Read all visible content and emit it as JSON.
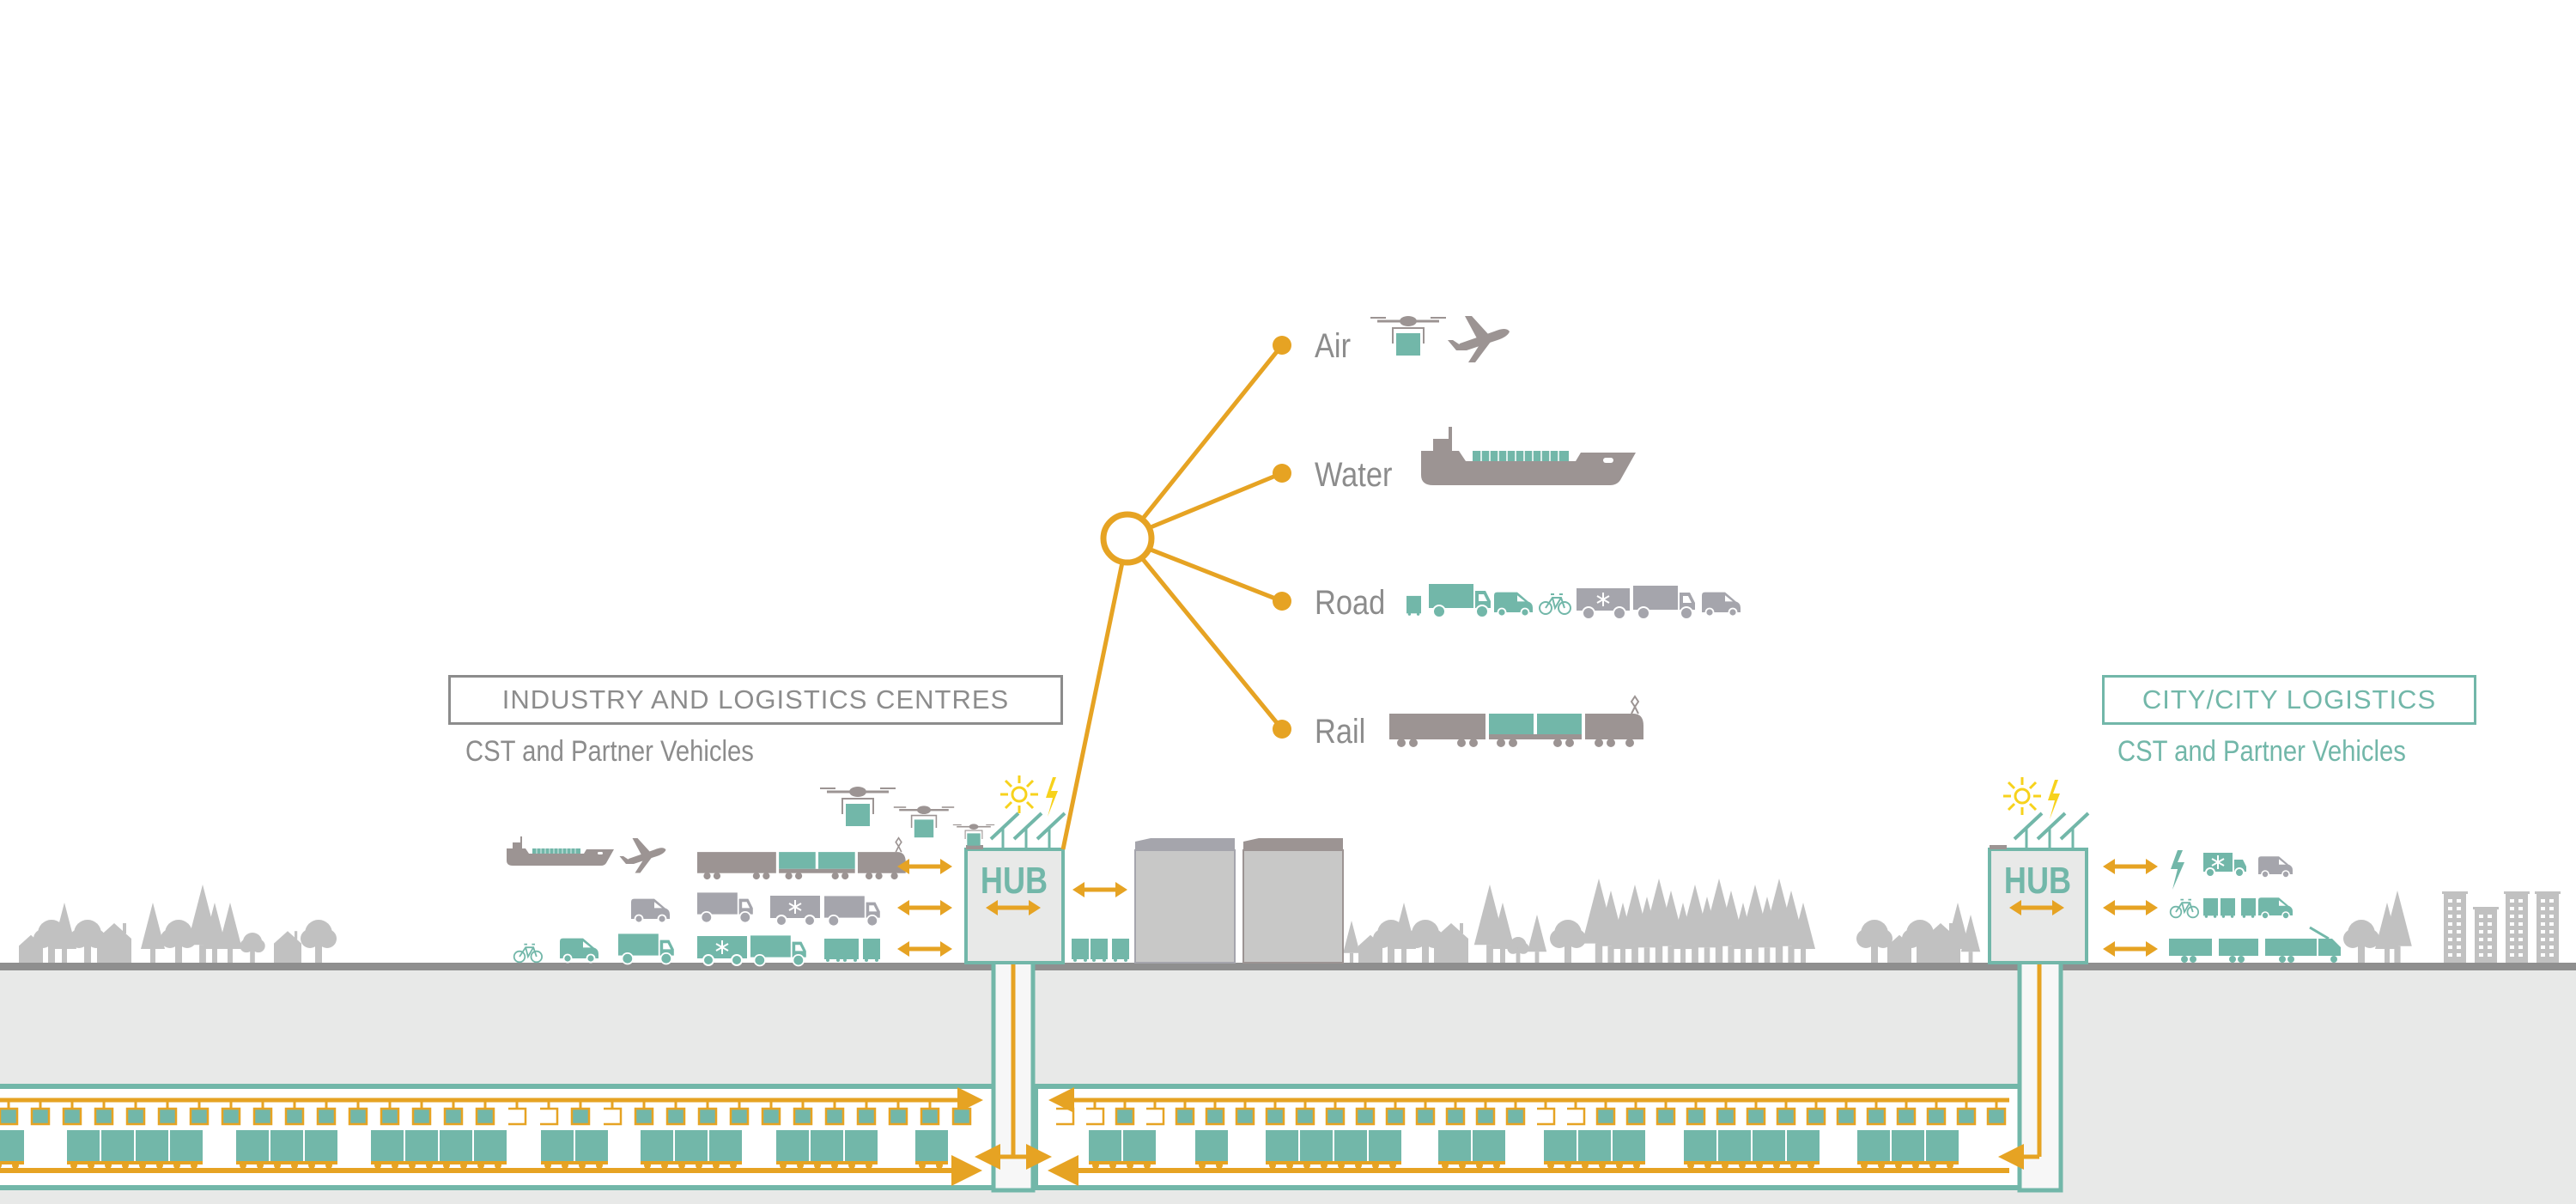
{
  "colors": {
    "orange": "#E6A323",
    "teal": "#72B7A9",
    "grey_vehicle": "#9C9493",
    "grey_truck": "#A5A5AC",
    "grey_skyline": "#C1C1C1",
    "ground_line": "#8F8F8F",
    "underground": "#E8E9E8",
    "label_grey": "#8C8C8C",
    "sun_yellow": "#F7D21C"
  },
  "modes": [
    {
      "id": "air",
      "label": "Air",
      "icons": [
        "drone-icon",
        "airplane-icon"
      ]
    },
    {
      "id": "water",
      "label": "Water",
      "icons": [
        "cargo-ship-icon"
      ]
    },
    {
      "id": "road",
      "label": "Road",
      "icons": [
        "cargo-box-icon",
        "truck-icon",
        "van-icon",
        "bicycle-icon",
        "refrigerated-truck-trailer-icon",
        "van-icon"
      ]
    },
    {
      "id": "rail",
      "label": "Rail",
      "icons": [
        "freight-train-icon"
      ]
    }
  ],
  "left_panel": {
    "title": "INDUSTRY AND LOGISTICS CENTRES",
    "subtitle": "CST and Partner Vehicles"
  },
  "right_panel": {
    "title": "CITY/CITY LOGISTICS",
    "subtitle": "CST and Partner Vehicles"
  },
  "hubs": [
    {
      "id": "hub-left",
      "label": "HUB"
    },
    {
      "id": "hub-right",
      "label": "HUB"
    }
  ]
}
